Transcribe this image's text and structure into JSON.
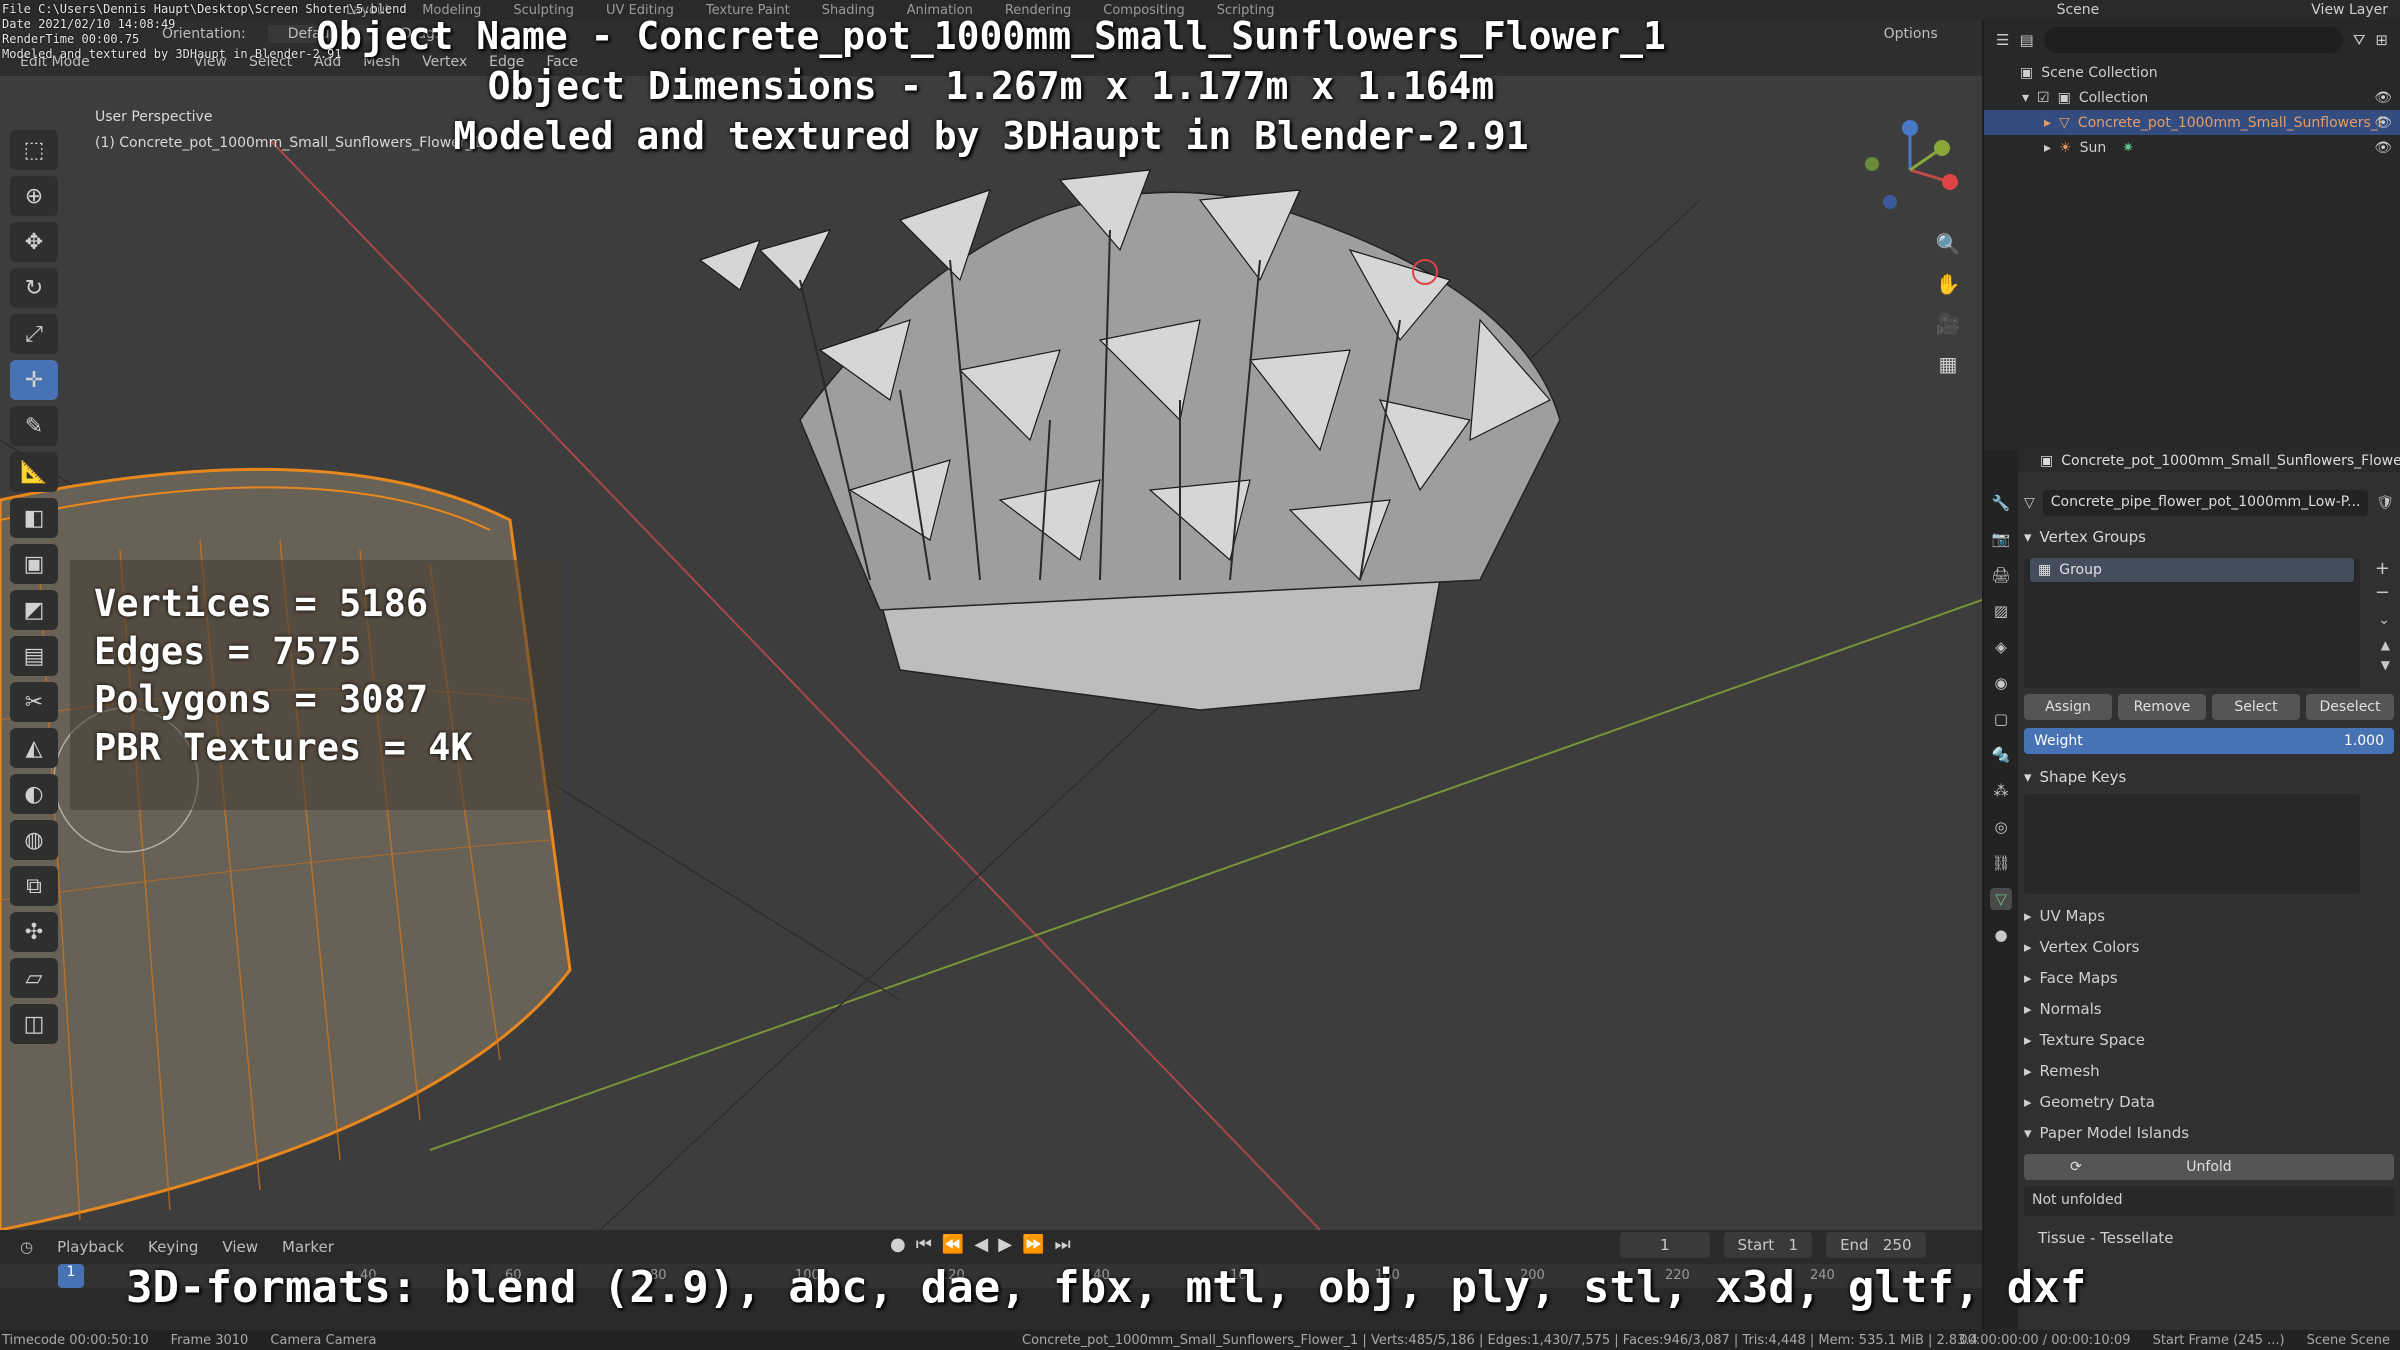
{
  "app": {
    "info_lines": [
      "File C:\\Users\\Dennis Haupt\\Desktop\\Screen Shoter\\5.blend",
      "Date 2021/02/10 14:08:49",
      "RenderTime 00:00.75",
      "Modeled and textured by 3DHaupt in Blender-2.91"
    ],
    "workspace_tabs": [
      "Layout",
      "Modeling",
      "Sculpting",
      "UV Editing",
      "Texture Paint",
      "Shading",
      "Animation",
      "Rendering",
      "Compositing",
      "Scripting"
    ],
    "scene": "Scene",
    "view_layer": "View Layer"
  },
  "overlay": {
    "line1": "Object Name - Concrete_pot_1000mm_Small_Sunflowers_Flower_1",
    "line2": "Object Dimensions -  1.267m x 1.177m x 1.164m",
    "line3": "Modeled and textured by 3DHaupt in Blender-2.91",
    "formats": "3D-formats: blend (2.9), abc, dae, fbx, mtl, obj, ply, stl, x3d, gltf, dxf"
  },
  "viewport": {
    "header_row1": [
      "Orientation:",
      "Default",
      "Drag:",
      "Options"
    ],
    "header_row2": [
      "Edit Mode",
      "View",
      "Select",
      "Add",
      "Mesh",
      "Vertex",
      "Edge",
      "Face"
    ],
    "perspective": "User Perspective",
    "object_label": "(1) Concrete_pot_1000mm_Small_Sunflowers_Flower_1"
  },
  "stats": {
    "vertices": "Vertices = 5186",
    "edges": "Edges = 7575",
    "polygons": "Polygons = 3087",
    "textures": "PBR Textures = 4K"
  },
  "timeline": {
    "menus": [
      "Playback",
      "Keying",
      "View",
      "Marker"
    ],
    "current_frame": "1",
    "start_label": "Start",
    "start": "1",
    "end_label": "End",
    "end": "250",
    "ruler": [
      "0",
      "20",
      "40",
      "60",
      "80",
      "100",
      "120",
      "140",
      "160",
      "180",
      "200",
      "220",
      "240"
    ]
  },
  "status": {
    "timecode": "Timecode 00:00:50:10",
    "frame": "Frame 3010",
    "camera": "Camera Camera",
    "stats": "Concrete_pot_1000mm_Small_Sunflowers_Flower_1 | Verts:485/5,186 | Edges:1,430/7,575 | Faces:946/3,087 | Tris:4,448 | Mem: 535.1 MiB | 2.83.4",
    "time": "00:00:00:00 / 00:00:10:09",
    "start_frame": "Start Frame (245 ...)",
    "scene": "Scene Scene"
  },
  "outliner": {
    "scene_collection": "Scene Collection",
    "collection": "Collection",
    "object": "Concrete_pot_1000mm_Small_Sunflowers_F",
    "sun": "Sun"
  },
  "properties": {
    "object_name": "Concrete_pot_1000mm_Small_Sunflowers_Flower",
    "mesh_name": "Concrete_pipe_flower_pot_1000mm_Low-P...",
    "vertex_groups": "Vertex Groups",
    "group_item": "Group",
    "buttons": [
      "Assign",
      "Remove",
      "Select",
      "Deselect"
    ],
    "weight_label": "Weight",
    "weight_value": "1.000",
    "shape_keys": "Shape Keys",
    "collapsed_sections": [
      "UV Maps",
      "Vertex Colors",
      "Face Maps",
      "Normals",
      "Texture Space",
      "Remesh",
      "Geometry Data"
    ],
    "paper_model": "Paper Model Islands",
    "unfold": "Unfold",
    "not_unfolded": "Not unfolded",
    "tissue": "Tissue - Tessellate"
  },
  "colors": {
    "accent": "#4772b3",
    "selection_orange": "#e79a63",
    "x_axis": "#c44a4a",
    "y_axis": "#8aa83a"
  },
  "icons": [
    "select-box-icon",
    "cursor-icon",
    "move-icon",
    "rotate-icon",
    "scale-icon",
    "transform-icon",
    "annotate-icon",
    "measure-icon",
    "extrude-icon",
    "inset-icon",
    "bevel-icon",
    "loop-cut-icon",
    "knife-icon",
    "poly-build-icon",
    "spin-icon",
    "smooth-icon",
    "edge-slide-icon",
    "shrink-icon",
    "shear-icon",
    "rip-icon"
  ]
}
